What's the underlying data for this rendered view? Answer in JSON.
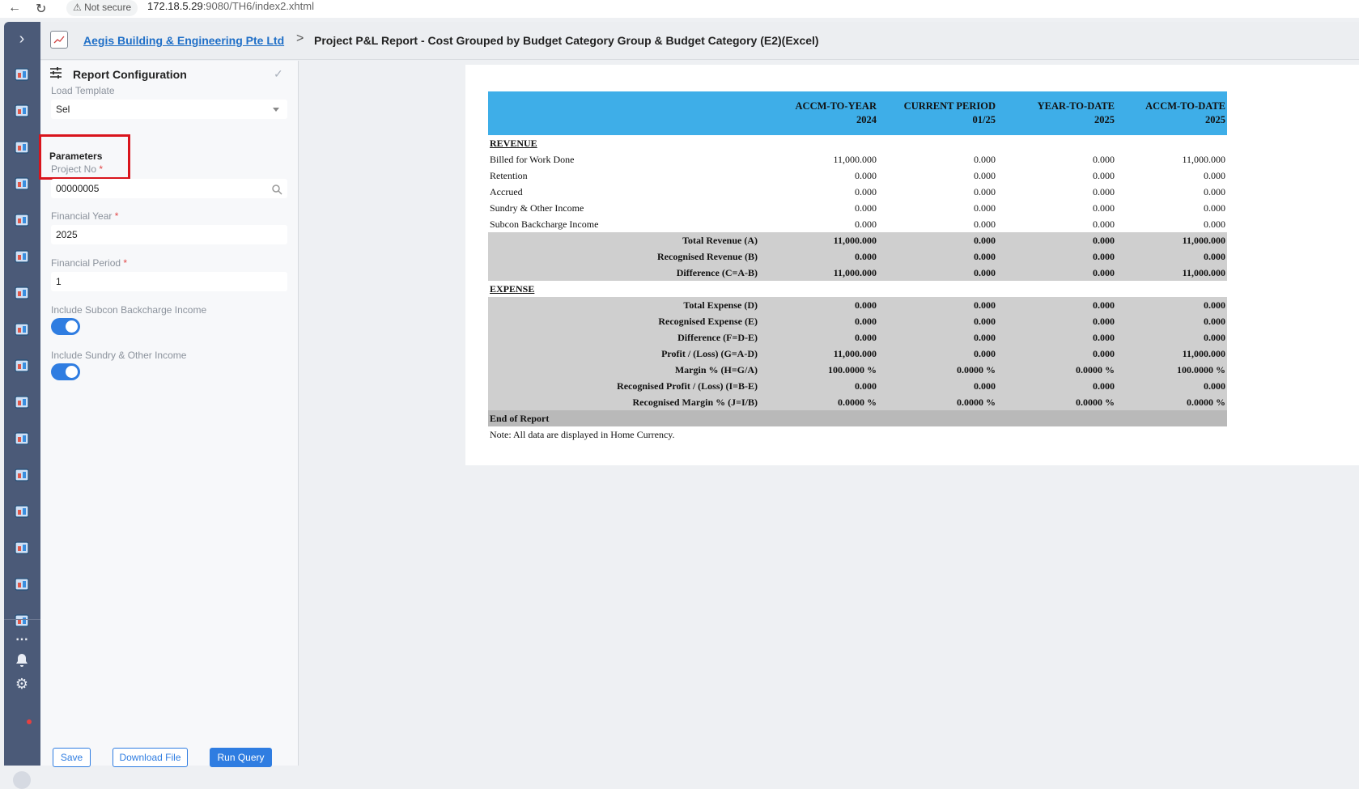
{
  "browser": {
    "security": "Not secure",
    "url_host": "172.18.5.29",
    "url_rest": ":9080/TH6/index2.xhtml"
  },
  "header": {
    "company": "Aegis Building & Engineering Pte Ltd",
    "separator": ">",
    "title": "Project P&L Report - Cost Grouped by Budget Category Group & Budget Category (E2)(Excel)"
  },
  "panel": {
    "title": "Report Configuration",
    "load_template_label": "Load Template",
    "load_template_value": "Sel",
    "parameters_label": "Parameters",
    "required_mark": "*",
    "project_no_label": "Project No",
    "project_no_value": "00000005",
    "financial_year_label": "Financial Year",
    "financial_year_value": "2025",
    "financial_period_label": "Financial Period",
    "financial_period_value": "1",
    "subcon_label": "Include Subcon Backcharge Income",
    "subcon_on": true,
    "sundry_label": "Include Sundry & Other Income",
    "sundry_on": true,
    "save_label": "Save",
    "download_label": "Download File",
    "run_label": "Run Query"
  },
  "report": {
    "columns": [
      {
        "name": "ACCM-TO-YEAR",
        "sub": "2024"
      },
      {
        "name": "CURRENT PERIOD",
        "sub": "01/25"
      },
      {
        "name": "YEAR-TO-DATE",
        "sub": "2025"
      },
      {
        "name": "ACCM-TO-DATE",
        "sub": "2025"
      }
    ],
    "revenue_label": "REVENUE",
    "revenue_rows": [
      {
        "label": "Billed for Work Done",
        "values": [
          "11,000.000",
          "0.000",
          "0.000",
          "11,000.000"
        ]
      },
      {
        "label": "Retention",
        "values": [
          "0.000",
          "0.000",
          "0.000",
          "0.000"
        ]
      },
      {
        "label": "Accrued",
        "values": [
          "0.000",
          "0.000",
          "0.000",
          "0.000"
        ]
      },
      {
        "label": "Sundry & Other Income",
        "values": [
          "0.000",
          "0.000",
          "0.000",
          "0.000"
        ]
      },
      {
        "label": "Subcon Backcharge Income",
        "values": [
          "0.000",
          "0.000",
          "0.000",
          "0.000"
        ]
      }
    ],
    "revenue_totals": [
      {
        "label": "Total Revenue (A)",
        "values": [
          "11,000.000",
          "0.000",
          "0.000",
          "11,000.000"
        ]
      },
      {
        "label": "Recognised Revenue (B)",
        "values": [
          "0.000",
          "0.000",
          "0.000",
          "0.000"
        ]
      },
      {
        "label": "Difference (C=A-B)",
        "values": [
          "11,000.000",
          "0.000",
          "0.000",
          "11,000.000"
        ]
      }
    ],
    "expense_label": "EXPENSE",
    "expense_totals": [
      {
        "label": "Total Expense (D)",
        "values": [
          "0.000",
          "0.000",
          "0.000",
          "0.000"
        ]
      },
      {
        "label": "Recognised Expense (E)",
        "values": [
          "0.000",
          "0.000",
          "0.000",
          "0.000"
        ]
      },
      {
        "label": "Difference (F=D-E)",
        "values": [
          "0.000",
          "0.000",
          "0.000",
          "0.000"
        ]
      },
      {
        "label": "Profit / (Loss) (G=A-D)",
        "values": [
          "11,000.000",
          "0.000",
          "0.000",
          "11,000.000"
        ]
      },
      {
        "label": "Margin % (H=G/A)",
        "values": [
          "100.0000 %",
          "0.0000 %",
          "0.0000 %",
          "100.0000 %"
        ]
      },
      {
        "label": "Recognised Profit / (Loss) (I=B-E)",
        "values": [
          "0.000",
          "0.000",
          "0.000",
          "0.000"
        ]
      },
      {
        "label": "Recognised Margin % (J=I/B)",
        "values": [
          "0.0000 %",
          "0.0000 %",
          "0.0000 %",
          "0.0000 %"
        ]
      }
    ],
    "end_label": "End of Report",
    "note": "Note: All data are displayed in Home Currency."
  },
  "rail_icons": [
    "dashboard-icon",
    "modules-icon",
    "store-icon",
    "book-icon",
    "documents-icon",
    "cart-icon",
    "reports-icon",
    "tools-icon",
    "factory-icon",
    "ledger-icon",
    "team-icon",
    "inbox-icon",
    "warehouse-icon",
    "truck-icon",
    "invoice-icon",
    "gauge-icon"
  ]
}
